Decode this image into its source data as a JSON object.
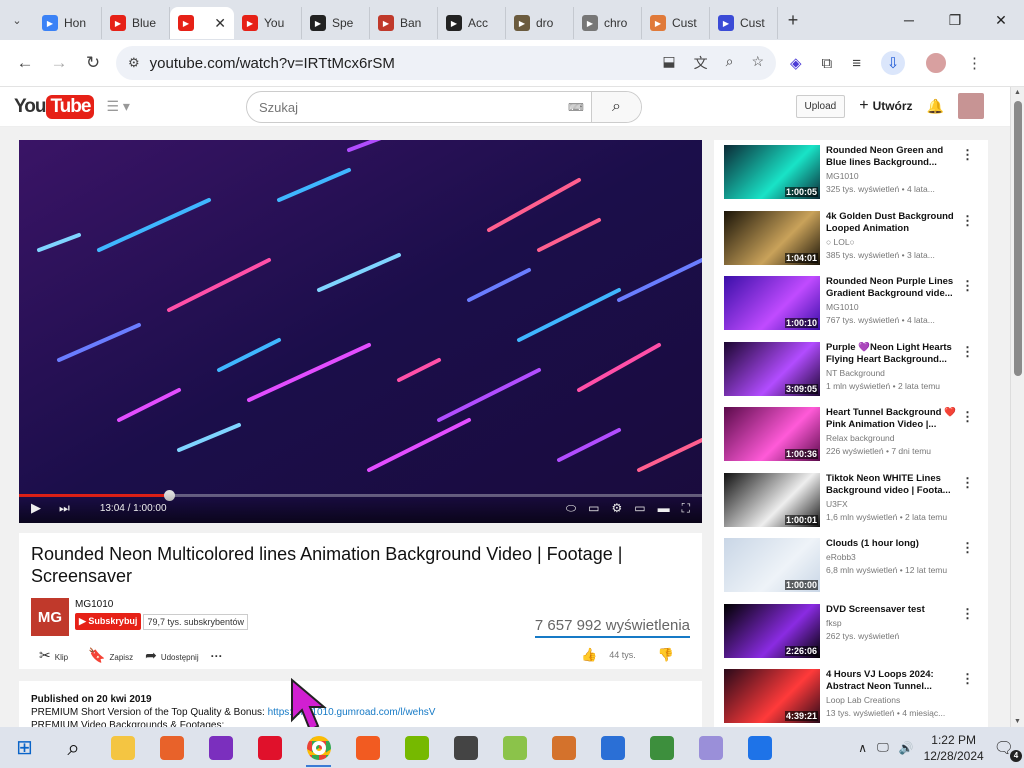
{
  "browser": {
    "tabs": [
      {
        "title": "Hon",
        "icon": "youtube-studio-icon",
        "color": "#3b82f6"
      },
      {
        "title": "Blue",
        "icon": "youtube-icon",
        "color": "#e62117"
      },
      {
        "title": "",
        "icon": "youtube-icon",
        "color": "#e62117",
        "active": true
      },
      {
        "title": "You",
        "icon": "youtube-icon",
        "color": "#e62117"
      },
      {
        "title": "Spe",
        "icon": "speedtest-icon",
        "color": "#222222"
      },
      {
        "title": "Ban",
        "icon": "record-icon",
        "color": "#c0392b"
      },
      {
        "title": "Acc",
        "icon": "github-icon",
        "color": "#222222"
      },
      {
        "title": "dro",
        "icon": "image-thumb-icon",
        "color": "#6b5b3e"
      },
      {
        "title": "chro",
        "icon": "globe-icon",
        "color": "#777777"
      },
      {
        "title": "Cust",
        "icon": "rainbow-icon",
        "color": "#e07a3a"
      },
      {
        "title": "Cust",
        "icon": "extension-store-icon",
        "color": "#3b4bd6"
      }
    ],
    "url": "youtube.com/watch?v=IRTtMcx6rSM",
    "new_tab": "+",
    "win_min": "─",
    "win_max": "❐",
    "win_close": "✕"
  },
  "yt": {
    "logo_you": "You",
    "logo_tube": "Tube",
    "search_placeholder": "Szukaj",
    "upload": "Upload",
    "create": "Utwórz",
    "create_plus": "+"
  },
  "player": {
    "time": "13:04 / 1:00:00",
    "progress": 0.22
  },
  "video": {
    "title": "Rounded Neon Multicolored lines Animation Background Video | Footage | Screensaver",
    "channel": "MG1010",
    "channel_logo": "MG",
    "subscribe": "Subskrybuj",
    "subscribers": "79,7 tys. subskrybentów",
    "views": "7 657 992 wyświetlenia",
    "clip": "Klip",
    "save": "Zapisz",
    "share": "Udostępnij",
    "more": "···",
    "likes": "44 tys."
  },
  "description": {
    "published": "Published on 20 kwi 2019",
    "line1_prefix": "PREMIUM Short Version of the Top Quality & Bonus: ",
    "line1_link": "https://mg1010.gumroad.com/l/wehsV",
    "line2": "PREMIUM Video Backgrounds & Footages:"
  },
  "recommendations": [
    {
      "title": "Rounded Neon Green and Blue lines Background...",
      "channel": "MG1010",
      "views": "325 tys. wyświetleń",
      "age": "4 lata...",
      "duration": "1:00:05",
      "colors": [
        "#0b2a36",
        "#19e3c7"
      ]
    },
    {
      "title": "4k Golden Dust Background Looped Animation",
      "channel": "○ LOL○",
      "views": "385 tys. wyświetleń",
      "age": "3 lata...",
      "duration": "1:04:01",
      "colors": [
        "#1a1408",
        "#c9a25a"
      ]
    },
    {
      "title": "Rounded Neon Purple Lines Gradient Background vide...",
      "channel": "MG1010",
      "views": "767 tys. wyświetleń",
      "age": "4 lata...",
      "duration": "1:00:10",
      "colors": [
        "#3a0fa8",
        "#c04bff"
      ]
    },
    {
      "title": "Purple 💜Neon Light Hearts Flying Heart Background...",
      "channel": "NT Background",
      "views": "1 mln wyświetleń",
      "age": "2 lata temu",
      "duration": "3:09:05",
      "colors": [
        "#1b0630",
        "#b24cff"
      ]
    },
    {
      "title": "Heart Tunnel Background ❤️Pink Animation Video |...",
      "channel": "Relax background",
      "views": "226 wyświetleń",
      "age": "7 dni temu",
      "duration": "1:00:36",
      "colors": [
        "#5a0a4a",
        "#ff5ad8"
      ]
    },
    {
      "title": "Tiktok Neon WHITE Lines Background video | Foota...",
      "channel": "U3FX",
      "views": "1,6 mln wyświetleń",
      "age": "2 lata temu",
      "duration": "1:00:01",
      "colors": [
        "#111111",
        "#eeeeee"
      ]
    },
    {
      "title": "Clouds (1 hour long)",
      "channel": "eRobb3",
      "views": "6,8 mln wyświetleń",
      "age": "12 lat temu",
      "duration": "1:00:00",
      "colors": [
        "#c9d6e6",
        "#eef3f8"
      ]
    },
    {
      "title": "DVD Screensaver test",
      "channel": "fksp",
      "views": "262 tys. wyświetleń",
      "age": "",
      "duration": "2:26:06",
      "colors": [
        "#000000",
        "#8a2be2"
      ]
    },
    {
      "title": "4 Hours VJ Loops 2024: Abstract Neon Tunnel...",
      "channel": "Loop Lab Creations",
      "views": "13 tys. wyświetleń",
      "age": "4 miesiąc...",
      "duration": "4:39:21",
      "colors": [
        "#2a0a1a",
        "#ff3a3a"
      ]
    }
  ],
  "taskbar": {
    "apps": [
      {
        "name": "start-icon",
        "color": "#0a64c8"
      },
      {
        "name": "search-icon",
        "color": "#111111"
      },
      {
        "name": "file-explorer-icon",
        "color": "#f4c542"
      },
      {
        "name": "firefox-icon",
        "color": "#e8622a"
      },
      {
        "name": "onenote-icon",
        "color": "#7b2fbe"
      },
      {
        "name": "opera-icon",
        "color": "#e0112b"
      },
      {
        "name": "chrome-icon",
        "color": "#34a853"
      },
      {
        "name": "brave-icon",
        "color": "#f25b21"
      },
      {
        "name": "nvidia-icon",
        "color": "#76b900"
      },
      {
        "name": "calendar-app-icon",
        "color": "#444444"
      },
      {
        "name": "green-app-icon",
        "color": "#8bc34a"
      },
      {
        "name": "eye-app-icon",
        "color": "#d4722c"
      },
      {
        "name": "r-app-icon",
        "color": "#2a6fd6"
      },
      {
        "name": "network-app-icon",
        "color": "#3d8f3d"
      },
      {
        "name": "ghost-app-icon",
        "color": "#9a8fd9"
      },
      {
        "name": "blue-circle-app-icon",
        "color": "#1e73e8"
      }
    ],
    "time": "1:22 PM",
    "date": "12/28/2024",
    "notifications": "4"
  }
}
